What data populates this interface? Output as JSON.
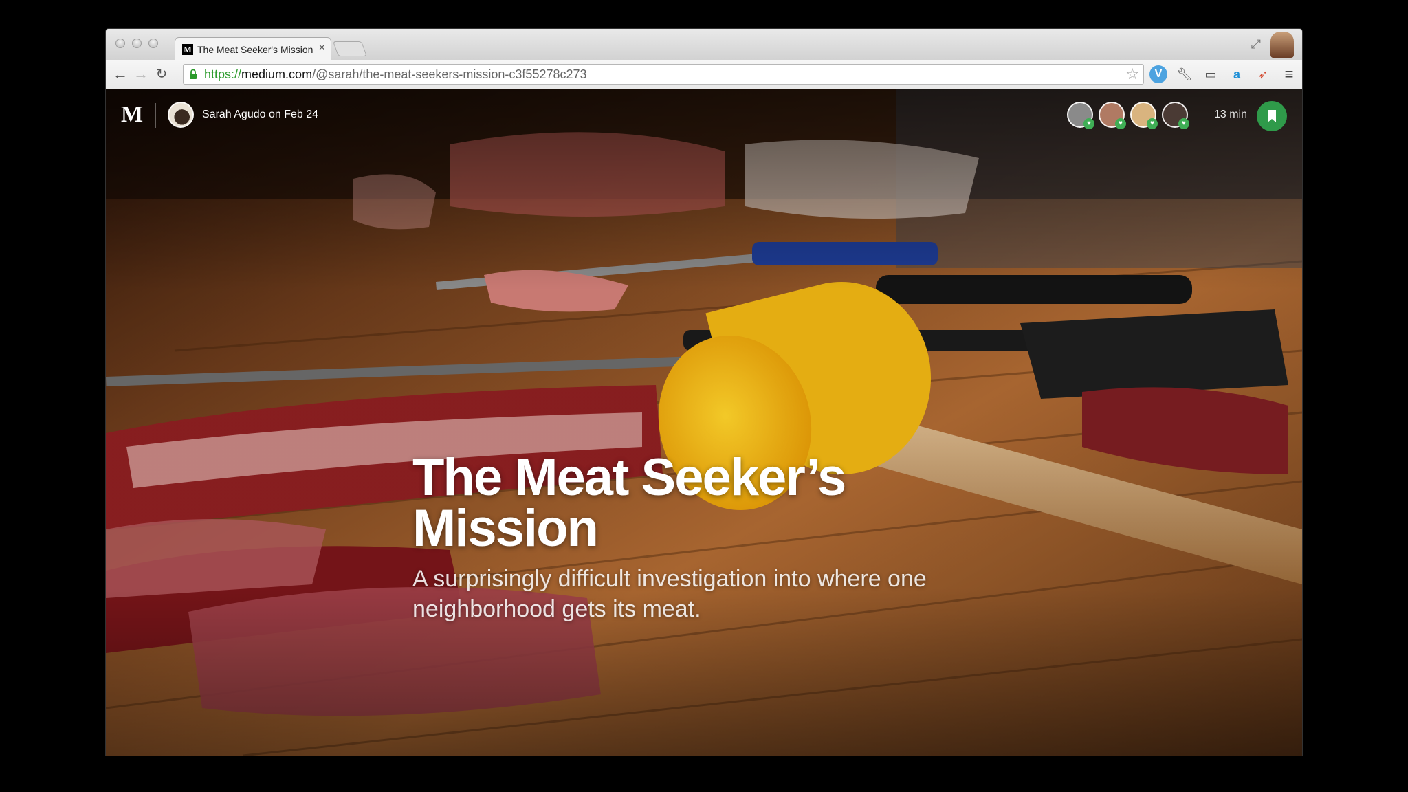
{
  "browser": {
    "tab_title": "The Meat Seeker's Mission",
    "tab_favicon": "M",
    "tab_close": "×",
    "url_scheme": "https://",
    "url_host": "medium.com",
    "url_path": "/@sarah/the-meat-seekers-mission-c3f55278c273",
    "ext_v_letter": "V",
    "ext_amazon_letter": "a"
  },
  "article": {
    "logo": "M",
    "author_meta": "Sarah Agudo on Feb 24",
    "read_time": "13 min",
    "title": "The Meat Seeker’s Mission",
    "subtitle": "A surprisingly difficult investigation into where one neighborhood gets its meat."
  },
  "readers": [
    {
      "name": "reader-1",
      "color": "#8a8a8a"
    },
    {
      "name": "reader-2",
      "color": "#b07a63"
    },
    {
      "name": "reader-3",
      "color": "#d9b47f"
    },
    {
      "name": "reader-4",
      "color": "#4a3a34"
    }
  ],
  "colors": {
    "accent_green": "#2f9a4a",
    "url_scheme_green": "#2a9a2a"
  }
}
